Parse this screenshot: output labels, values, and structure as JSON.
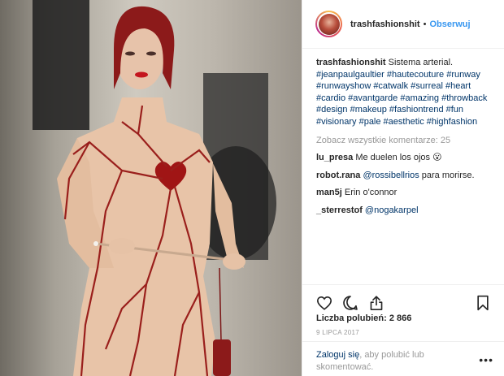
{
  "post": {
    "username": "trashfashionshit",
    "follow_label": "Obserwuj",
    "separator": "•",
    "caption_text": "Sistema arterial.",
    "hashtags": "#jeanpaulgaultier #hautecouture #runway #runwayshow #catwalk #surreal #heart #cardio #avantgarde #amazing #throwback #design #makeup #fashiontrend #fun #visionary #pale #aesthetic #highfashion",
    "view_all_comments": "Zobacz wszystkie komentarze: 25",
    "comments": [
      {
        "user": "lu_presa",
        "text": "Me duelen los ojos 😮",
        "mention": ""
      },
      {
        "user": "robot.rana",
        "text": " para morirse.",
        "mention": "@rossibellrios"
      },
      {
        "user": "man5j",
        "text": "Erin o'connor",
        "mention": ""
      },
      {
        "user": "_sterrestof",
        "text": "",
        "mention": "@nogakarpel"
      }
    ],
    "likes_label": "Liczba polubień: 2 866",
    "date": "9 LIPCA 2017",
    "login_link": "Zaloguj się",
    "login_rest": ", aby polubić lub skomentować.",
    "more_label": "•••"
  },
  "icons": {
    "like": "heart-outline-icon",
    "comment": "speech-bubble-icon",
    "share": "share-icon",
    "save": "bookmark-icon"
  },
  "colors": {
    "link_blue": "#3897f0",
    "text": "#262626",
    "muted": "#999999",
    "tag_blue": "#003569",
    "suit_red": "#9a1f1c"
  }
}
